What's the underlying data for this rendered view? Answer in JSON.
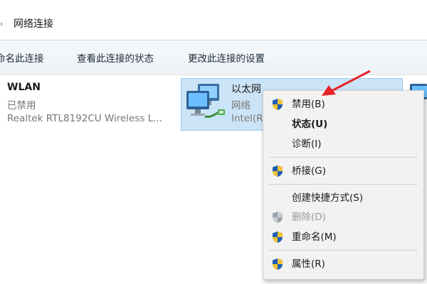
{
  "breadcrumb": {
    "chevron": "›",
    "location": "网络连接"
  },
  "toolbar": {
    "rename": "命名此连接",
    "view_status": "查看此连接的状态",
    "change_settings": "更改此连接的设置"
  },
  "connections": [
    {
      "name": "WLAN",
      "status": "已禁用",
      "device": "Realtek RTL8192CU Wireless L..."
    },
    {
      "name": "以太网",
      "status": "网络",
      "device": "Intel(R"
    }
  ],
  "context_menu": {
    "items": [
      {
        "label": "禁用(B)",
        "icon": "uac-shield-icon",
        "bold": false,
        "disabled": false
      },
      {
        "label": "状态(U)",
        "icon": "",
        "bold": true,
        "disabled": false
      },
      {
        "label": "诊断(I)",
        "icon": "",
        "bold": false,
        "disabled": false
      },
      {
        "label": "桥接(G)",
        "icon": "uac-shield-icon",
        "bold": false,
        "disabled": false
      },
      {
        "label": "创建快捷方式(S)",
        "icon": "",
        "bold": false,
        "disabled": false
      },
      {
        "label": "删除(D)",
        "icon": "uac-shield-icon",
        "bold": false,
        "disabled": true
      },
      {
        "label": "重命名(M)",
        "icon": "uac-shield-icon",
        "bold": false,
        "disabled": false
      },
      {
        "label": "属性(R)",
        "icon": "uac-shield-icon",
        "bold": false,
        "disabled": false
      }
    ]
  },
  "colors": {
    "selection_bg": "#cce4f7",
    "selection_border": "#99c9ef",
    "menu_bg": "#f2f2f2",
    "annotation_arrow": "#e8232a",
    "disabled_text": "#9a9a9a"
  }
}
